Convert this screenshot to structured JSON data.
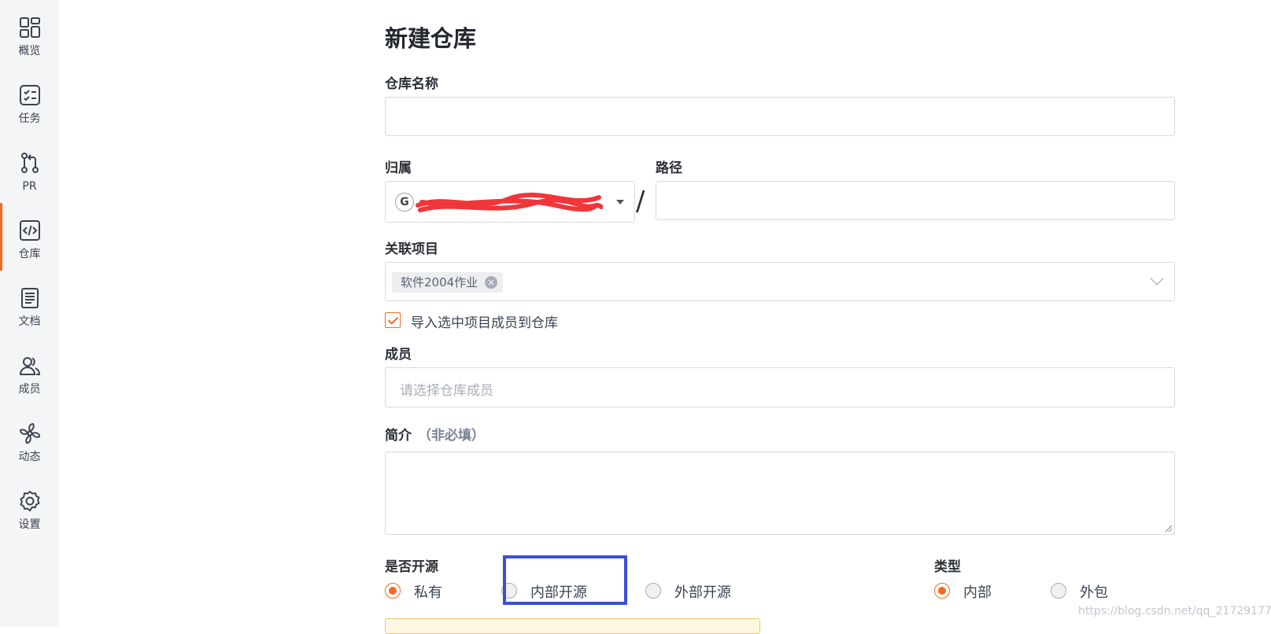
{
  "sidebar": {
    "items": [
      {
        "label": "概览",
        "icon": "overview-icon"
      },
      {
        "label": "任务",
        "icon": "tasks-icon"
      },
      {
        "label": "PR",
        "icon": "pull-request-icon"
      },
      {
        "label": "仓库",
        "icon": "code-icon",
        "active": true
      },
      {
        "label": "文档",
        "icon": "document-icon"
      },
      {
        "label": "成员",
        "icon": "members-icon"
      },
      {
        "label": "动态",
        "icon": "activity-icon"
      },
      {
        "label": "设置",
        "icon": "gear-icon"
      }
    ]
  },
  "form": {
    "title": "新建仓库",
    "repo_name": {
      "label": "仓库名称",
      "value": ""
    },
    "owner": {
      "label": "归属",
      "avatar_letter": "G"
    },
    "slash": "/",
    "path": {
      "label": "路径",
      "value": ""
    },
    "project": {
      "label": "关联项目",
      "tag": "软件2004作业"
    },
    "import_members": {
      "label": "导入选中项目成员到仓库",
      "checked": true
    },
    "members": {
      "label": "成员",
      "placeholder": "请选择仓库成员"
    },
    "description": {
      "label": "简介",
      "optional": "（非必填）",
      "value": ""
    },
    "open_source": {
      "label": "是否开源",
      "options": [
        "私有",
        "内部开源",
        "外部开源"
      ],
      "selected": "私有"
    },
    "type": {
      "label": "类型",
      "options": [
        "内部",
        "外包"
      ],
      "selected": "内部"
    }
  },
  "watermark": "https://blog.csdn.net/qq_21729177",
  "colors": {
    "accent": "#f46a1f",
    "highlight_box": "#3b4fd8",
    "sidebar_bg": "#f4f5f7"
  }
}
